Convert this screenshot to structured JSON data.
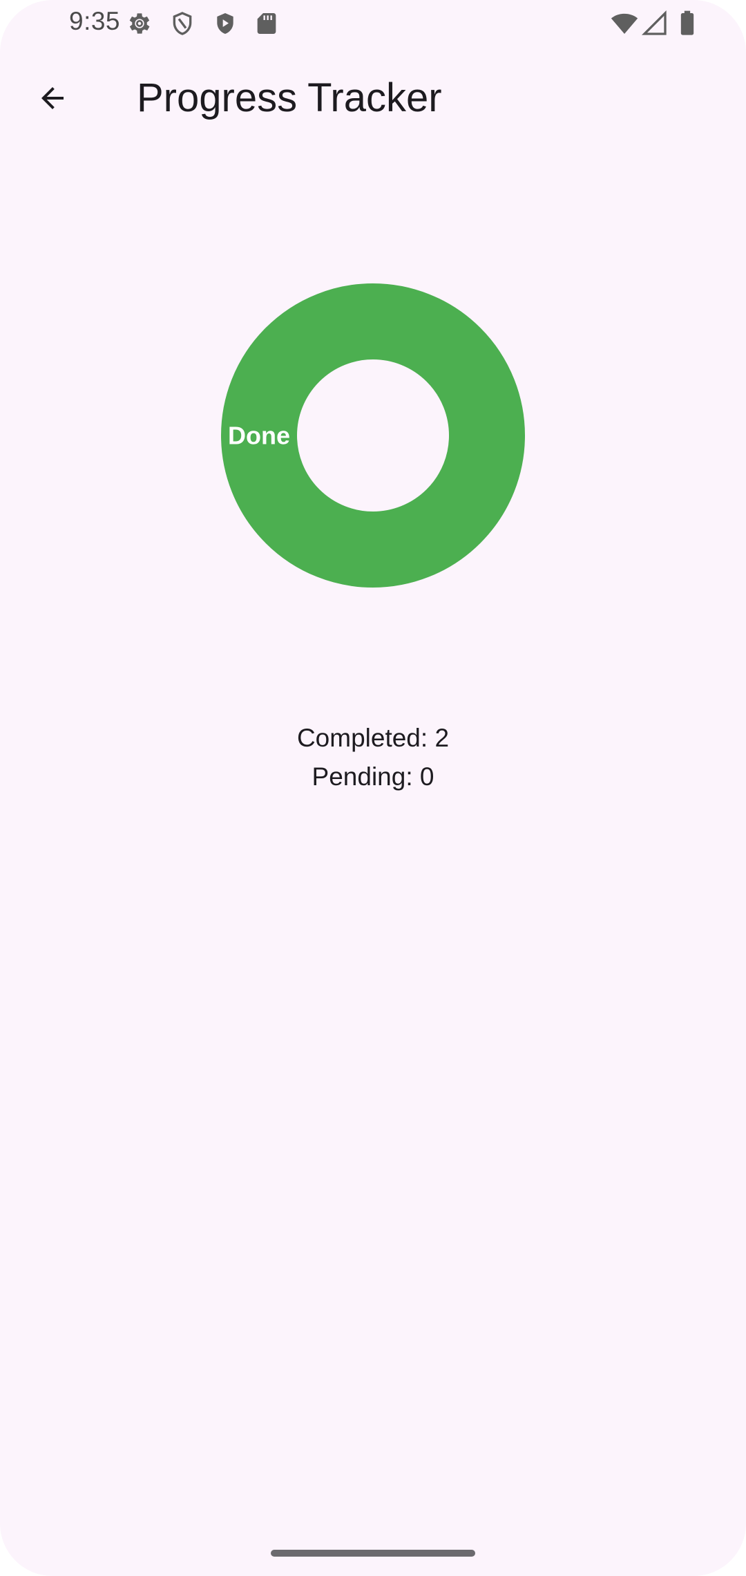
{
  "status_bar": {
    "time": "9:35",
    "left_icons": [
      "gear-icon",
      "shield-outline-icon",
      "play-shield-icon",
      "sd-card-icon"
    ],
    "right_icons": [
      "wifi-icon",
      "signal-icon",
      "battery-icon"
    ]
  },
  "app_bar": {
    "back_icon": "arrow-back-icon",
    "title": "Progress Tracker"
  },
  "chart_data": {
    "type": "pie",
    "style": "donut",
    "categories": [
      "Done"
    ],
    "values": [
      2
    ],
    "colors": [
      "#4caf50"
    ],
    "label_color": "#ffffff"
  },
  "summary": {
    "completed_label": "Completed: 2",
    "pending_label": "Pending: 0"
  },
  "colors": {
    "background": "#fcf4fc",
    "done": "#4caf50",
    "text": "#1d1b20"
  }
}
